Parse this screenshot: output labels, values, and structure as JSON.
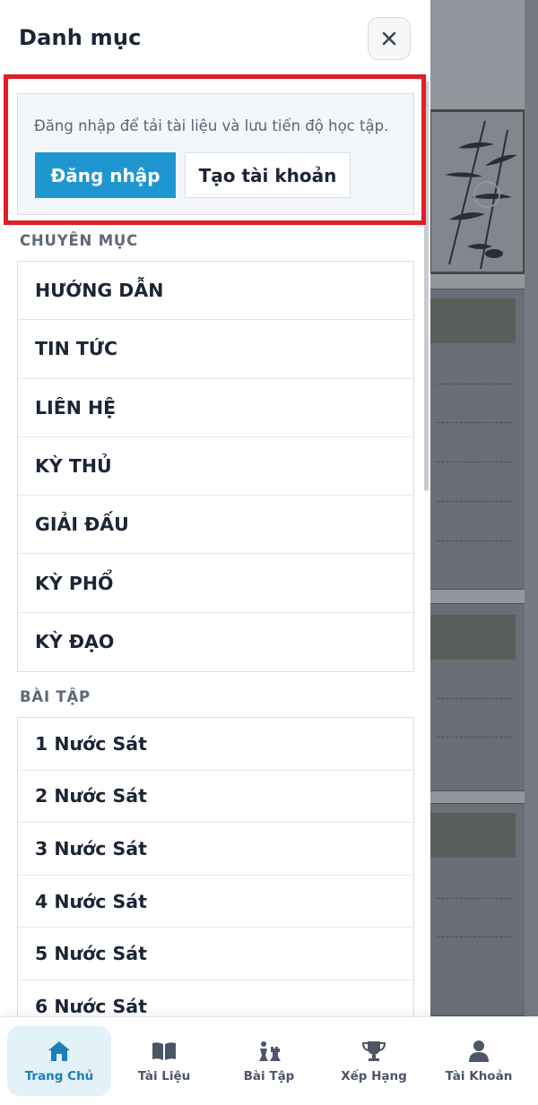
{
  "drawer": {
    "title": "Danh mục",
    "close_icon": "close-icon"
  },
  "login": {
    "prompt": "Đăng nhập để tải tài liệu và lưu tiến độ học tập.",
    "login_label": "Đăng nhập",
    "register_label": "Tạo tài khoản"
  },
  "categories": {
    "heading": "CHUYÊN MỤC",
    "items": [
      "HƯỚNG DẪN",
      "TIN TỨC",
      "LIÊN HỆ",
      "KỲ THỦ",
      "GIẢI ĐẤU",
      "KỲ PHỔ",
      "KỲ ĐẠO"
    ]
  },
  "exercises": {
    "heading": "BÀI TẬP",
    "items": [
      "1 Nước Sát",
      "2 Nước Sát",
      "3 Nước Sát",
      "4 Nước Sát",
      "5 Nước Sát",
      "6 Nước Sát"
    ]
  },
  "bottom_nav": {
    "items": [
      {
        "label": "Trang Chủ",
        "icon": "home-icon",
        "active": true
      },
      {
        "label": "Tài Liệu",
        "icon": "book-icon",
        "active": false
      },
      {
        "label": "Bài Tập",
        "icon": "chess-pieces-icon",
        "active": false
      },
      {
        "label": "Xếp Hạng",
        "icon": "trophy-icon",
        "active": false
      },
      {
        "label": "Tài Khoản",
        "icon": "user-icon",
        "active": false
      }
    ]
  },
  "colors": {
    "accent": "#1f96d0",
    "active_nav_bg": "#e3f1f9",
    "highlight": "#e01e26",
    "text": "#1b2535",
    "muted": "#5d6878"
  }
}
